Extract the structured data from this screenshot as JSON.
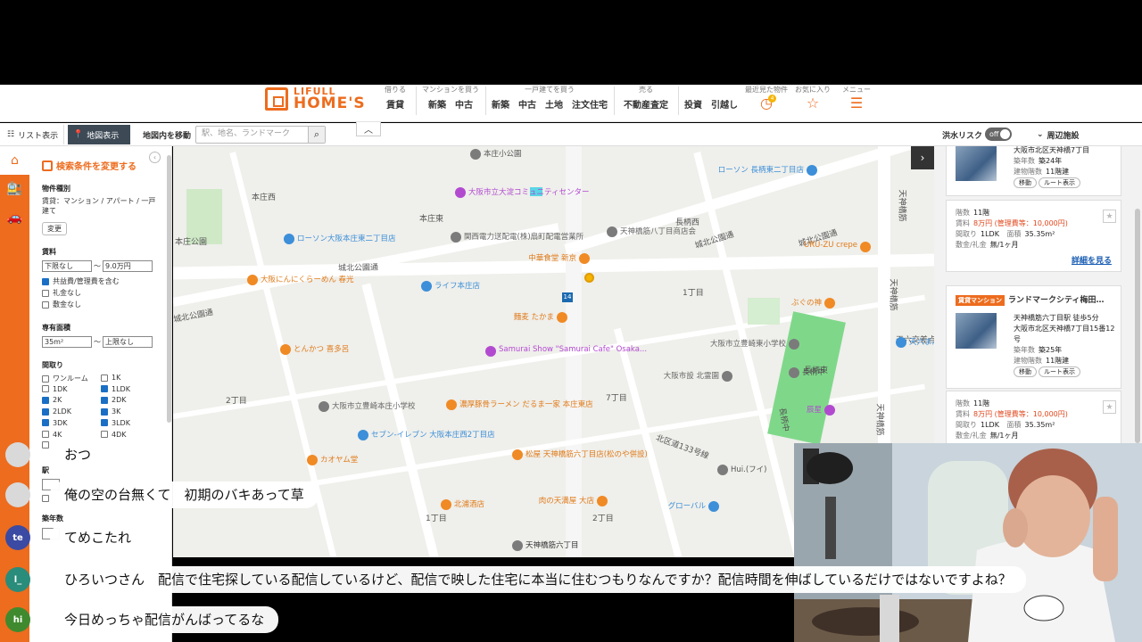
{
  "header": {
    "logo_top": "LIFULL",
    "logo_bottom": "HOME'S",
    "groups": [
      {
        "caption": "借りる",
        "items": [
          "賃貸"
        ]
      },
      {
        "caption": "マンションを買う",
        "items": [
          "新築",
          "中古"
        ]
      },
      {
        "caption": "一戸建てを買う",
        "items": [
          "新築",
          "中古",
          "土地",
          "注文住宅"
        ]
      },
      {
        "caption": "売る",
        "items": [
          "不動産査定"
        ]
      },
      {
        "caption": "",
        "items": [
          "投資",
          "引越し"
        ]
      }
    ],
    "recent_caption": "最近見た物件",
    "recent_count": "4",
    "fav_caption": "お気に入り",
    "menu_caption": "メニュー"
  },
  "toolbar": {
    "list_view": "リスト表示",
    "map_view": "地図表示",
    "move_label": "地図内を移動",
    "search_placeholder": "駅、地名、ランドマーク",
    "flood_risk": "洪水リスク",
    "flood_toggle": "off",
    "nearby": "周辺施設"
  },
  "sidebar": {
    "title": "検索条件を変更する",
    "property_type_label": "物件種別",
    "property_type_value": "賃貸：マンション / アパート / 一戸建て",
    "change_button": "変更",
    "rent_label": "賃料",
    "rent_min": "下限なし",
    "rent_tilde": "〜",
    "rent_max": "9.0万円",
    "rent_options": [
      {
        "label": "共益費/管理費を含む",
        "checked": true
      },
      {
        "label": "礼金なし",
        "checked": false
      },
      {
        "label": "敷金なし",
        "checked": false
      }
    ],
    "area_label": "専有面積",
    "area_min": "35m²",
    "area_max": "上限なし",
    "layout_label": "間取り",
    "layouts": [
      {
        "label": "ワンルーム",
        "checked": false
      },
      {
        "label": "1K",
        "checked": false
      },
      {
        "label": "1DK",
        "checked": false
      },
      {
        "label": "1LDK",
        "checked": true
      },
      {
        "label": "2K",
        "checked": true
      },
      {
        "label": "2DK",
        "checked": true
      },
      {
        "label": "2LDK",
        "checked": true
      },
      {
        "label": "3K",
        "checked": true
      },
      {
        "label": "3DK",
        "checked": true
      },
      {
        "label": "3LDK",
        "checked": true
      },
      {
        "label": "4K",
        "checked": false
      },
      {
        "label": "4DK",
        "checked": false
      }
    ],
    "station_label": "駅",
    "age_label": "築年数"
  },
  "map": {
    "road_labels": [
      "城北公園通",
      "城北公園通",
      "城北公園通",
      "城北公園通",
      "天神橋筋",
      "天神橋筋",
      "天神橋筋",
      "長柄西",
      "本庄西",
      "本庄東",
      "長柄中",
      "長柄東",
      "2丁目",
      "1丁目",
      "7丁目",
      "1丁目",
      "2丁目",
      "北区道133号線",
      "天六交差点",
      "本庄公園"
    ],
    "places": [
      {
        "name": "大阪市立大淀コミュニティセンター",
        "color": "#b24ad0",
        "kind": "pp"
      },
      {
        "name": "関西電力送配電(株)扇町配電営業所",
        "color": "#666666",
        "kind": "pg"
      },
      {
        "name": "天神橋筋八丁目商店会",
        "color": "#666666",
        "kind": "pg"
      },
      {
        "name": "ローソン大阪本庄東二丁目店",
        "color": "#3c8fd8",
        "kind": "pb"
      },
      {
        "name": "ローソン 長柄東二丁目店",
        "color": "#3c8fd8",
        "kind": "pb"
      },
      {
        "name": "大阪にんにくらーめん 春光",
        "color": "#e07b1a",
        "kind": "po"
      },
      {
        "name": "中華食堂 新京",
        "color": "#e07b1a",
        "kind": "po"
      },
      {
        "name": "URU-ZU crepe",
        "color": "#e07b1a",
        "kind": "po"
      },
      {
        "name": "ライフ本庄店",
        "color": "#3c8fd8",
        "kind": "pb"
      },
      {
        "name": "ぶぐの神",
        "color": "#e07b1a",
        "kind": "po"
      },
      {
        "name": "麵麦 たかま",
        "color": "#e07b1a",
        "kind": "po"
      },
      {
        "name": "とんかつ 喜多呂",
        "color": "#e07b1a",
        "kind": "po"
      },
      {
        "name": "Samurai Show \"Samurai Cafe\" Osaka...",
        "color": "#b24ad0",
        "kind": "pp"
      },
      {
        "name": "大阪市立豊崎東小学校",
        "color": "#666666",
        "kind": "pg"
      },
      {
        "name": "天六まん",
        "color": "#3c8fd8",
        "kind": "pb"
      },
      {
        "name": "大阪市設 北霊園",
        "color": "#666666",
        "kind": "pg"
      },
      {
        "name": "長柄中",
        "color": "#555555",
        "kind": "pg"
      },
      {
        "name": "大阪市立豊崎本庄小学校",
        "color": "#666666",
        "kind": "pg"
      },
      {
        "name": "濃厚豚骨ラーメン だるま一家 本庄東店",
        "color": "#e07b1a",
        "kind": "po"
      },
      {
        "name": "辰星",
        "color": "#b24ad0",
        "kind": "pp"
      },
      {
        "name": "セブン-イレブン 大阪本庄西2丁目店",
        "color": "#3c8fd8",
        "kind": "pb"
      },
      {
        "name": "松屋 天神橋筋六丁目店(松のや併設)",
        "color": "#e07b1a",
        "kind": "po"
      },
      {
        "name": "カオヤム堂",
        "color": "#e07b1a",
        "kind": "po"
      },
      {
        "name": "Hui.(フイ)",
        "color": "#555555",
        "kind": "pg"
      },
      {
        "name": "北浦酒店",
        "color": "#e07b1a",
        "kind": "po"
      },
      {
        "name": "肉の天満屋 大店",
        "color": "#e07b1a",
        "kind": "po"
      },
      {
        "name": "グローバル",
        "color": "#3c8fd8",
        "kind": "pb"
      },
      {
        "name": "天神橋筋六丁目",
        "color": "#333333",
        "kind": "pg"
      },
      {
        "name": "本庄小公園",
        "color": "#555555",
        "kind": "pg"
      }
    ],
    "route_number": "14"
  },
  "listing_top": {
    "address": "大阪市北区天神橋7丁目",
    "age_key": "築年数",
    "age": "築24年",
    "floor_key": "建物階数",
    "floor": "11階建",
    "move_btn": "移動",
    "route_btn": "ルート表示",
    "unit_floor_key": "階数",
    "unit_floor": "11階",
    "rent_key": "賃料",
    "rent": "8万円 (管理費等：10,000円)",
    "layout_key": "間取り",
    "layout": "1LDK",
    "area_key": "面積",
    "area": "35.35m²",
    "deposit_key": "敷金/礼金",
    "deposit": "無/1ヶ月",
    "detail_link": "詳細を見る"
  },
  "listing_2": {
    "tag": "賃貸マンション",
    "name": "ランドマークシティ梅田…",
    "access": "天神橋筋六丁目駅 徒歩5分",
    "address": "大阪市北区天神橋7丁目15番12号",
    "age_key": "築年数",
    "age": "築25年",
    "floor_key": "建物階数",
    "floor": "11階建",
    "move_btn": "移動",
    "route_btn": "ルート表示",
    "unit_floor_key": "階数",
    "unit_floor": "11階",
    "rent_key": "賃料",
    "rent": "8万円 (管理費等：10,000円)",
    "layout_key": "間取り",
    "layout": "1LDK",
    "area_key": "面積",
    "area": "35.35m²",
    "deposit_key": "敷金/礼金",
    "deposit": "無/1ヶ月"
  },
  "chat": [
    {
      "avatar": "",
      "avatar_color": "#d9d9d9",
      "text": "おつ"
    },
    {
      "avatar": "",
      "avatar_color": "#d9d9d9",
      "text": "俺の空の台無くて　初期のバキあって草"
    },
    {
      "avatar": "te",
      "avatar_color": "#3b4aa3",
      "text": "てめこたれ"
    },
    {
      "avatar": "l_",
      "avatar_color": "#2a8c7a",
      "text": "ひろいつさん　配信で住宅探している配信しているけど、配信で映した住宅に本当に住むつもりなんですか？配信時間を伸ばしているだけではないですよね？"
    },
    {
      "avatar": "hi",
      "avatar_color": "#3f8a2f",
      "text": "今日めっちゃ配信がんばってるな"
    }
  ]
}
